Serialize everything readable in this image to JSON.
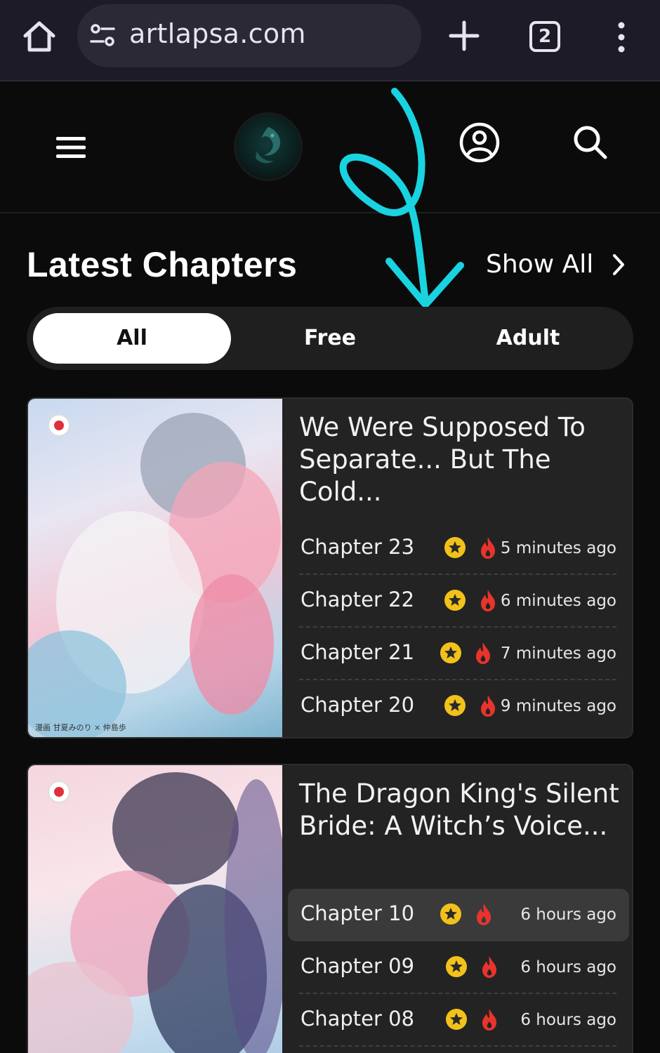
{
  "browser": {
    "url": "artlapsa.com",
    "tab_count": "2"
  },
  "section": {
    "title": "Latest Chapters",
    "show_all": "Show All"
  },
  "filters": [
    {
      "label": "All",
      "active": true
    },
    {
      "label": "Free",
      "active": false
    },
    {
      "label": "Adult",
      "active": false
    }
  ],
  "series": [
    {
      "title": "We Were Supposed To Separate... But The Cold...",
      "cover_credit": "漫画 甘夏みのり × 仲島歩",
      "chapters": [
        {
          "name": "Chapter 23",
          "time": "5 minutes ago"
        },
        {
          "name": "Chapter 22",
          "time": "6 minutes ago"
        },
        {
          "name": "Chapter 21",
          "time": "7 minutes ago"
        },
        {
          "name": "Chapter 20",
          "time": "9 minutes ago"
        }
      ]
    },
    {
      "title": "The Dragon King's Silent Bride: A Witch’s Voice...",
      "chapters": [
        {
          "name": "Chapter 10",
          "time": "6 hours ago"
        },
        {
          "name": "Chapter 09",
          "time": "6 hours ago"
        },
        {
          "name": "Chapter 08",
          "time": "6 hours ago"
        }
      ]
    }
  ],
  "colors": {
    "star_badge": "#f2c21b",
    "fire_badge": "#e8342c",
    "doodle": "#19d3e0"
  },
  "icons": [
    "home-icon",
    "site-settings-icon",
    "new-tab-icon",
    "tab-switcher-icon",
    "more-options-icon",
    "menu-icon",
    "user-icon",
    "search-icon",
    "chevron-right-icon",
    "star-icon",
    "fire-icon"
  ]
}
